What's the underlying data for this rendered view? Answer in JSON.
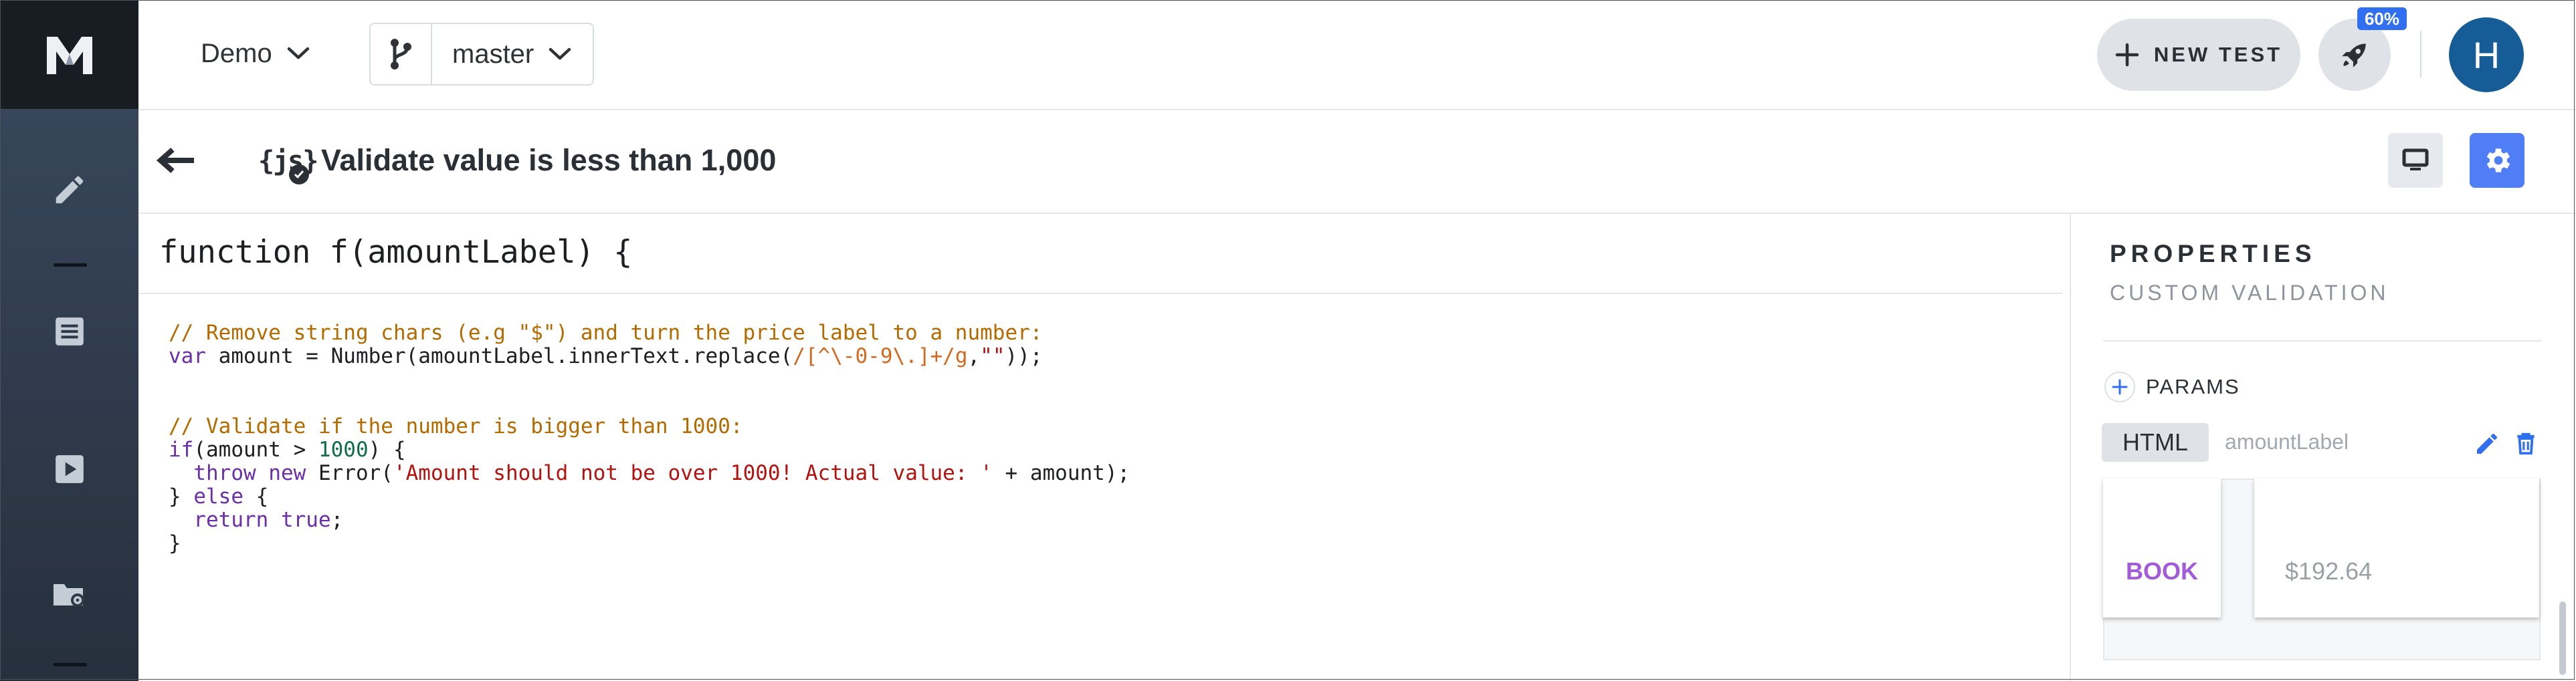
{
  "topbar": {
    "project": "Demo",
    "branch": "master",
    "new_test_label": "NEW TEST",
    "badge": "60%",
    "avatar_initial": "H"
  },
  "step": {
    "title": "Validate value is less than 1,000",
    "js_label": "{js}"
  },
  "editor": {
    "signature": "function f(amountLabel) {",
    "lines": [
      {
        "parts": [
          {
            "t": "// Remove string chars (e.g \"$\") and turn the price label to a number:",
            "k": "com"
          }
        ]
      },
      {
        "parts": [
          {
            "t": "var",
            "k": "kw"
          },
          {
            "t": " amount = Number(amountLabel.innerText.replace(",
            "k": ""
          },
          {
            "t": "/[^\\-0-9\\.]+/g",
            "k": "re"
          },
          {
            "t": ",",
            "k": ""
          },
          {
            "t": "\"\"",
            "k": "str"
          },
          {
            "t": "));",
            "k": ""
          }
        ]
      },
      {
        "parts": [
          {
            "t": "",
            "k": ""
          }
        ]
      },
      {
        "parts": [
          {
            "t": "",
            "k": ""
          }
        ]
      },
      {
        "parts": [
          {
            "t": "// Validate if the number is bigger than 1000:",
            "k": "com"
          }
        ]
      },
      {
        "parts": [
          {
            "t": "if",
            "k": "kw"
          },
          {
            "t": "(amount > ",
            "k": ""
          },
          {
            "t": "1000",
            "k": "num"
          },
          {
            "t": ") {",
            "k": ""
          }
        ]
      },
      {
        "parts": [
          {
            "t": "  ",
            "k": ""
          },
          {
            "t": "throw",
            "k": "kw"
          },
          {
            "t": " ",
            "k": ""
          },
          {
            "t": "new",
            "k": "kw"
          },
          {
            "t": " Error(",
            "k": ""
          },
          {
            "t": "'Amount should not be over 1000! Actual value: '",
            "k": "str"
          },
          {
            "t": " + amount);",
            "k": ""
          }
        ]
      },
      {
        "parts": [
          {
            "t": "} ",
            "k": ""
          },
          {
            "t": "else",
            "k": "kw"
          },
          {
            "t": " {",
            "k": ""
          }
        ]
      },
      {
        "parts": [
          {
            "t": "  ",
            "k": ""
          },
          {
            "t": "return",
            "k": "kw"
          },
          {
            "t": " ",
            "k": ""
          },
          {
            "t": "true",
            "k": "kw"
          },
          {
            "t": ";",
            "k": ""
          }
        ]
      },
      {
        "parts": [
          {
            "t": "}",
            "k": ""
          }
        ]
      }
    ]
  },
  "properties": {
    "title": "PROPERTIES",
    "subtitle": "CUSTOM VALIDATION",
    "params_label": "PARAMS",
    "param_type": "HTML",
    "param_name": "amountLabel",
    "preview_left": "BOOK",
    "preview_right": "$192.64"
  },
  "colors": {
    "accent": "#4f7ef6",
    "badge": "#2f6ff0",
    "avatar": "#165c96",
    "rail_top": "#3b4a60",
    "preview_link": "#a45bd9"
  },
  "icons": [
    "logo-icon",
    "pencil-icon",
    "list-icon",
    "play-icon",
    "folder-gear-icon",
    "chevron-down-icon",
    "branch-icon",
    "plus-icon",
    "rocket-icon",
    "arrow-left-icon",
    "check-icon",
    "monitor-icon",
    "gear-icon",
    "edit-icon",
    "trash-icon"
  ]
}
